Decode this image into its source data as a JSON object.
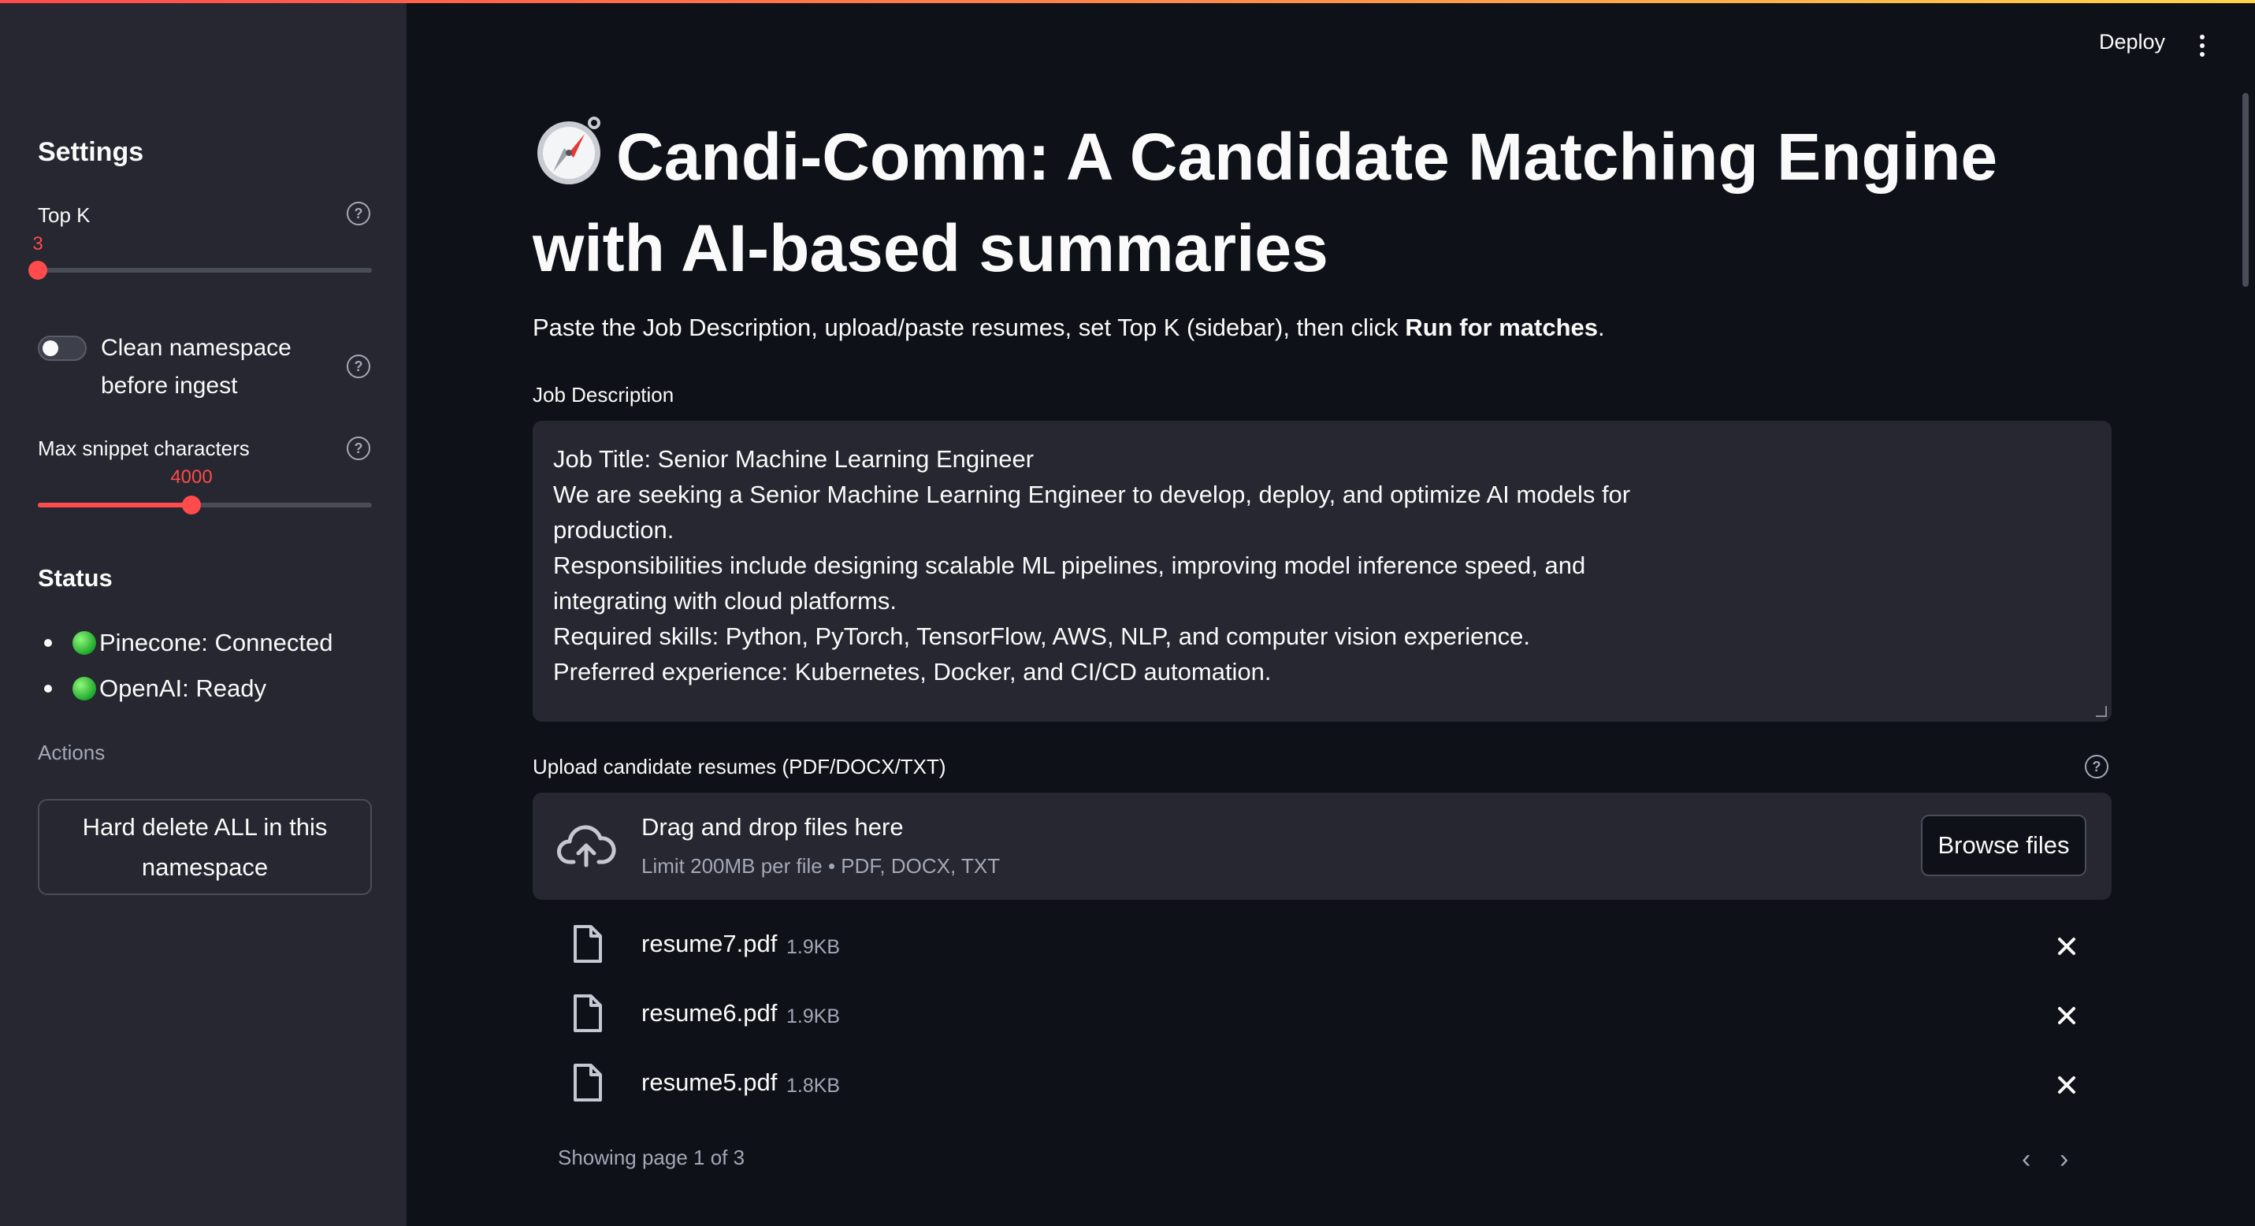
{
  "sidebar": {
    "title": "Settings",
    "top_k": {
      "label": "Top K",
      "value": "3",
      "fraction": 0.0
    },
    "clean_namespace": {
      "label": "Clean namespace before ingest",
      "enabled": false
    },
    "max_snippet": {
      "label": "Max snippet characters",
      "value": "4000",
      "fraction": 0.46
    },
    "status": {
      "title": "Status",
      "items": [
        {
          "label": "Pinecone: Connected",
          "state": "green"
        },
        {
          "label": "OpenAI: Ready",
          "state": "green"
        }
      ]
    },
    "actions": {
      "label": "Actions",
      "hard_delete_label": "Hard delete ALL in this namespace"
    }
  },
  "header": {
    "deploy_label": "Deploy",
    "menu_icon": "kebab-menu-icon"
  },
  "main": {
    "title_icon": "compass-icon",
    "title": "Candi-Comm: A Candidate Matching Engine with AI-based summaries",
    "intro_prefix": "Paste the Job Description, upload/paste resumes, set Top K (sidebar), then click ",
    "intro_bold": "Run for matches",
    "intro_suffix": ".",
    "job_description": {
      "label": "Job Description",
      "lines": [
        "Job Title: Senior Machine Learning Engineer",
        "We are seeking a Senior Machine Learning Engineer to develop, deploy, and optimize AI models for",
        "production.",
        "Responsibilities include designing scalable ML pipelines, improving model inference speed, and",
        "integrating with cloud platforms.",
        "Required skills: Python, PyTorch, TensorFlow, AWS, NLP, and computer vision experience.",
        "Preferred experience: Kubernetes, Docker, and CI/CD automation."
      ]
    },
    "uploader": {
      "label": "Upload candidate resumes (PDF/DOCX/TXT)",
      "drop_title": "Drag and drop files here",
      "drop_limit": "Limit 200MB per file • PDF, DOCX, TXT",
      "browse_label": "Browse files",
      "files": [
        {
          "name": "resume7.pdf",
          "size": "1.9KB"
        },
        {
          "name": "resume6.pdf",
          "size": "1.9KB"
        },
        {
          "name": "resume5.pdf",
          "size": "1.8KB"
        }
      ],
      "pagination": "Showing page 1 of 3"
    }
  },
  "colors": {
    "accent": "#ff4b4b",
    "background": "#0e1117",
    "sidebar": "#262730"
  }
}
